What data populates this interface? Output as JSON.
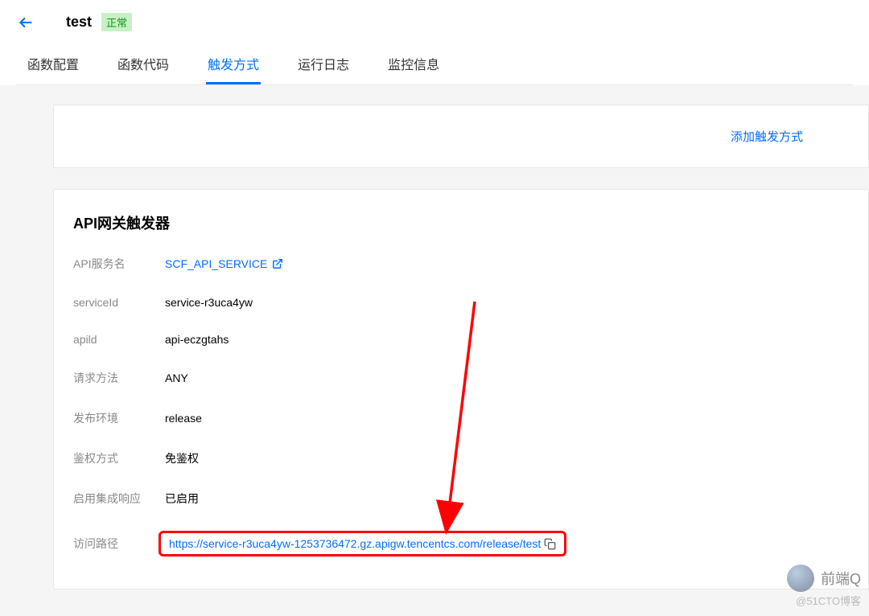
{
  "header": {
    "title": "test",
    "status": "正常"
  },
  "tabs": [
    {
      "label": "函数配置"
    },
    {
      "label": "函数代码"
    },
    {
      "label": "触发方式",
      "active": true
    },
    {
      "label": "运行日志"
    },
    {
      "label": "监控信息"
    }
  ],
  "add_trigger_label": "添加触发方式",
  "trigger": {
    "title": "API网关触发器",
    "rows": {
      "api_service_label": "API服务名",
      "api_service_value": "SCF_API_SERVICE",
      "service_id_label": "serviceId",
      "service_id_value": "service-r3uca4yw",
      "api_id_label": "apild",
      "api_id_value": "api-eczgtahs",
      "method_label": "请求方法",
      "method_value": "ANY",
      "env_label": "发布环境",
      "env_value": "release",
      "auth_label": "鉴权方式",
      "auth_value": "免鉴权",
      "integration_label": "启用集成响应",
      "integration_value": "已启用",
      "path_label": "访问路径",
      "path_value": "https://service-r3uca4yw-1253736472.gz.apigw.tencentcs.com/release/test"
    }
  },
  "watermark": {
    "main": "前端Q",
    "sub": "@51CTO博客"
  }
}
